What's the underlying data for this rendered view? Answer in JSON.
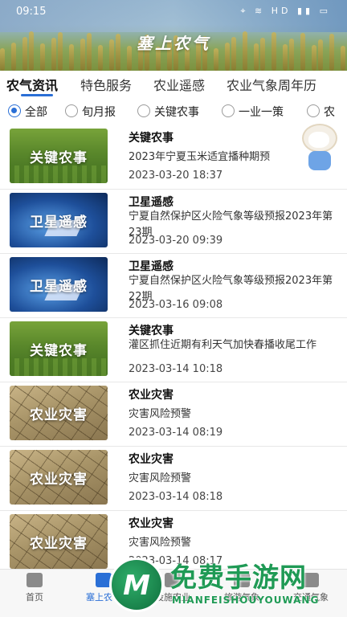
{
  "status_bar": {
    "time": "09:15",
    "icons": "⌖ ≋ HD ▮▮ ▭"
  },
  "app": {
    "title": "塞上农气"
  },
  "tabs": [
    {
      "label": "农气资讯",
      "active": true
    },
    {
      "label": "特色服务",
      "active": false
    },
    {
      "label": "农业遥感",
      "active": false
    },
    {
      "label": "农业气象周年历",
      "active": false
    }
  ],
  "filters": [
    {
      "label": "全部",
      "selected": true
    },
    {
      "label": "旬月报",
      "selected": false
    },
    {
      "label": "关键农事",
      "selected": false
    },
    {
      "label": "一业一策",
      "selected": false
    },
    {
      "label": "农",
      "selected": false
    }
  ],
  "news": [
    {
      "thumb_label": "关键农事",
      "thumb_style": "green",
      "category": "关键农事",
      "title": "2023年宁夏玉米适宜播种期预",
      "date": "2023-03-20 18:37"
    },
    {
      "thumb_label": "卫星遥感",
      "thumb_style": "blue",
      "category": "卫星遥感",
      "title": "宁夏自然保护区火险气象等级预报2023年第23期",
      "date": "2023-03-20 09:39"
    },
    {
      "thumb_label": "卫星遥感",
      "thumb_style": "blue",
      "category": "卫星遥感",
      "title": "宁夏自然保护区火险气象等级预报2023年第22期",
      "date": "2023-03-16 09:08"
    },
    {
      "thumb_label": "关键农事",
      "thumb_style": "green",
      "category": "关键农事",
      "title": "灌区抓住近期有利天气加快春播收尾工作",
      "date": "2023-03-14 10:18"
    },
    {
      "thumb_label": "农业灾害",
      "thumb_style": "dry",
      "category": "农业灾害",
      "title": "灾害风险预警",
      "date": "2023-03-14 08:19"
    },
    {
      "thumb_label": "农业灾害",
      "thumb_style": "dry",
      "category": "农业灾害",
      "title": "灾害风险预警",
      "date": "2023-03-14 08:18"
    },
    {
      "thumb_label": "农业灾害",
      "thumb_style": "dry",
      "category": "农业灾害",
      "title": "灾害风险预警",
      "date": "2023-03-14 08:17"
    }
  ],
  "bottom_nav": [
    {
      "label": "首页",
      "icon": "home-icon",
      "active": false
    },
    {
      "label": "塞上农气",
      "icon": "farm-icon",
      "active": true
    },
    {
      "label": "设施农业",
      "icon": "greenhouse-icon",
      "active": false
    },
    {
      "label": "旅游气象",
      "icon": "travel-icon",
      "active": false
    },
    {
      "label": "交通气象",
      "icon": "traffic-icon",
      "active": false
    }
  ],
  "watermark": {
    "big": "免费手游网",
    "small": "MIANFEISHOUYOUWANG"
  },
  "colors": {
    "accent": "#2a6fd6",
    "watermark": "#1f9a55"
  }
}
